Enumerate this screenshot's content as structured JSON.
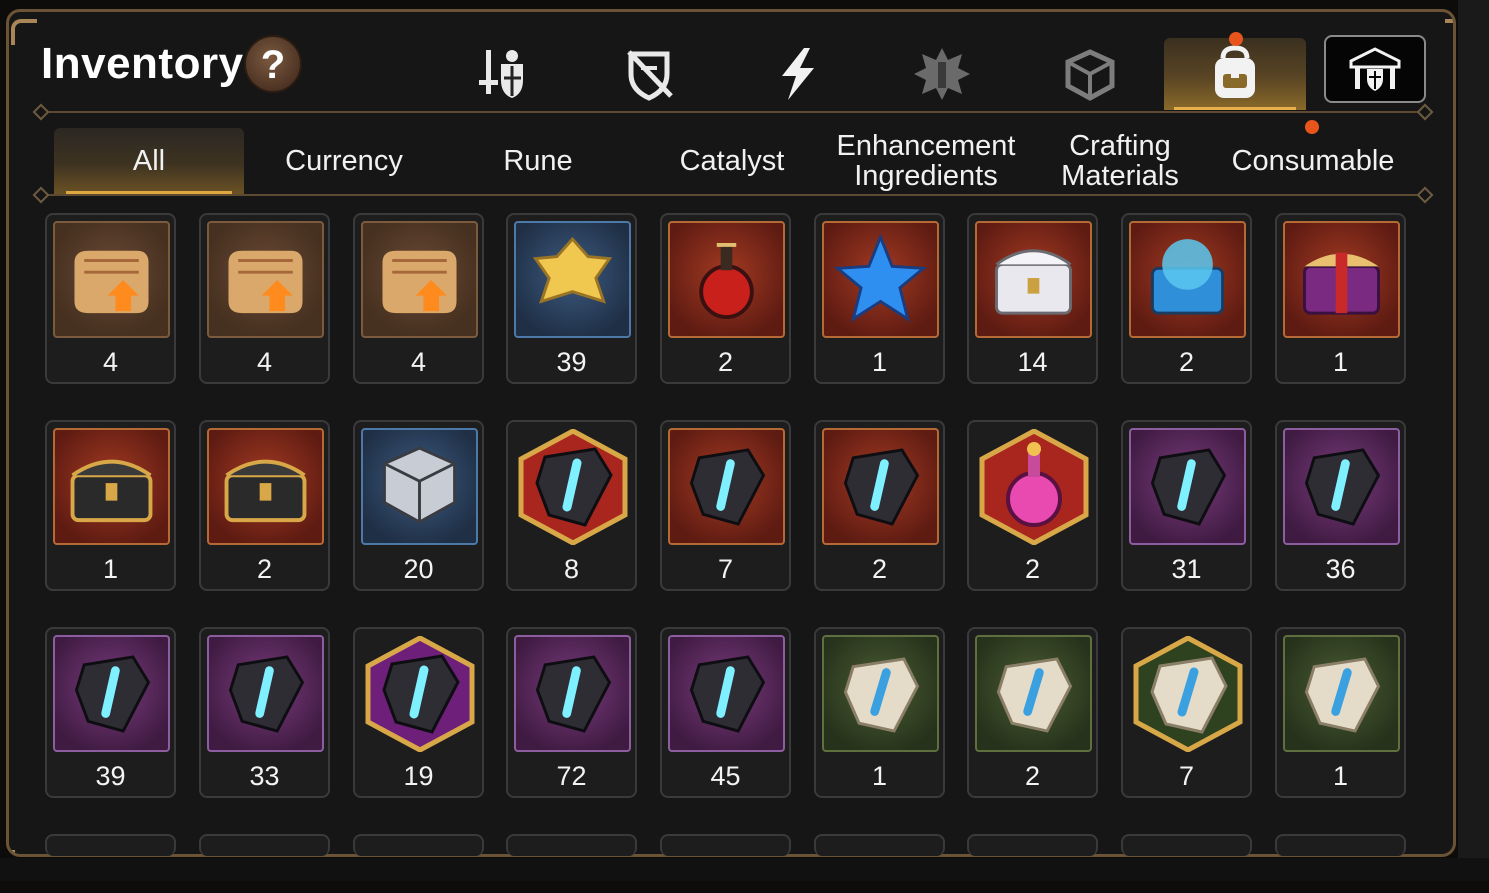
{
  "header": {
    "title": "Inventory",
    "help_label": "?"
  },
  "category_tabs": [
    {
      "name": "armor-sword-icon",
      "active": false
    },
    {
      "name": "crossed-shield-icon",
      "active": false
    },
    {
      "name": "lightning-icon",
      "active": false
    },
    {
      "name": "crest-icon",
      "active": false
    },
    {
      "name": "cube-icon",
      "active": false
    },
    {
      "name": "backpack-icon",
      "active": true,
      "badge": true
    },
    {
      "name": "shield-pass-icon",
      "active": false
    }
  ],
  "subtabs": [
    {
      "label": "All",
      "active": true
    },
    {
      "label": "Currency"
    },
    {
      "label": "Rune"
    },
    {
      "label": "Catalyst"
    },
    {
      "label": "Enhancement Ingredients"
    },
    {
      "label": "Crafting Materials"
    },
    {
      "label": "Consumable",
      "badge": true
    }
  ],
  "colors": {
    "accent": "#e8b04a",
    "badge": "#e8551c",
    "frame": "#6b5436",
    "panel": "#161616"
  },
  "items": [
    {
      "name": "upgrade-scroll-orange",
      "count": "4",
      "bg": "brown",
      "icon": "scroll"
    },
    {
      "name": "upgrade-scroll-rainbow",
      "count": "4",
      "bg": "brown",
      "icon": "scroll"
    },
    {
      "name": "upgrade-scroll-gold",
      "count": "4",
      "bg": "brown",
      "icon": "scroll"
    },
    {
      "name": "gold-crystal-cluster",
      "count": "39",
      "bg": "blue",
      "icon": "crystal"
    },
    {
      "name": "red-potion-flask",
      "count": "2",
      "bg": "red",
      "icon": "flask"
    },
    {
      "name": "blue-star-potion",
      "count": "1",
      "bg": "red",
      "icon": "star"
    },
    {
      "name": "silver-treasure-chest",
      "count": "14",
      "bg": "red",
      "icon": "chest-silver"
    },
    {
      "name": "blue-treasure-chest",
      "count": "2",
      "bg": "red",
      "icon": "chest-blue"
    },
    {
      "name": "gift-chest",
      "count": "1",
      "bg": "red",
      "icon": "gift"
    },
    {
      "name": "gold-black-chest",
      "count": "1",
      "bg": "red",
      "icon": "chest-gold"
    },
    {
      "name": "gold-black-chest-2",
      "count": "2",
      "bg": "red",
      "icon": "chest-gold"
    },
    {
      "name": "silver-cube",
      "count": "20",
      "bg": "blue",
      "icon": "cube"
    },
    {
      "name": "red-rune-star",
      "count": "8",
      "bg": "hex-red",
      "icon": "rune"
    },
    {
      "name": "red-rune-hammer",
      "count": "7",
      "bg": "red",
      "icon": "rune"
    },
    {
      "name": "red-rune-exclaim",
      "count": "2",
      "bg": "red",
      "icon": "rune"
    },
    {
      "name": "pink-potion-hex",
      "count": "2",
      "bg": "hex-red",
      "icon": "flask-pink"
    },
    {
      "name": "purple-rune-sword",
      "count": "31",
      "bg": "purple",
      "icon": "rune"
    },
    {
      "name": "purple-rune-swirl",
      "count": "36",
      "bg": "purple",
      "icon": "rune"
    },
    {
      "name": "purple-rune-armor",
      "count": "39",
      "bg": "purple",
      "icon": "rune"
    },
    {
      "name": "purple-rune-boot",
      "count": "33",
      "bg": "purple",
      "icon": "rune"
    },
    {
      "name": "purple-rune-star-hex",
      "count": "19",
      "bg": "hex-purple",
      "icon": "rune"
    },
    {
      "name": "purple-rune-hammer",
      "count": "72",
      "bg": "purple",
      "icon": "rune"
    },
    {
      "name": "purple-rune-exclaim",
      "count": "45",
      "bg": "purple",
      "icon": "rune"
    },
    {
      "name": "green-rune-sword",
      "count": "1",
      "bg": "green",
      "icon": "stone"
    },
    {
      "name": "green-rune-swirl",
      "count": "2",
      "bg": "green",
      "icon": "stone"
    },
    {
      "name": "green-rune-star-hex",
      "count": "7",
      "bg": "hex-green",
      "icon": "stone"
    },
    {
      "name": "green-rune-hammer",
      "count": "1",
      "bg": "green",
      "icon": "stone"
    }
  ]
}
